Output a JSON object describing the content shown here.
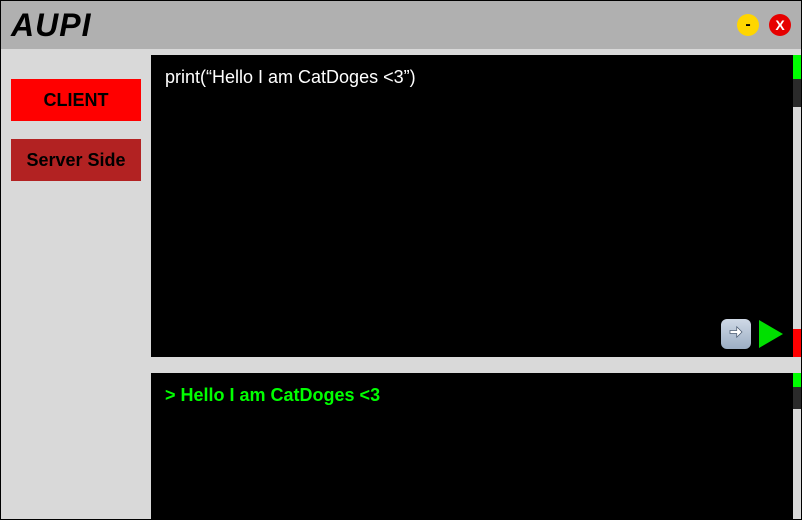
{
  "titlebar": {
    "title": "AUPI",
    "minimize_glyph": "-",
    "close_glyph": "X"
  },
  "sidebar": {
    "client_label": "CLIENT",
    "server_label": "Server Side"
  },
  "editor": {
    "code": "print(“Hello I am CatDoges <3”)"
  },
  "output": {
    "line": "> Hello I am CatDoges <3"
  }
}
